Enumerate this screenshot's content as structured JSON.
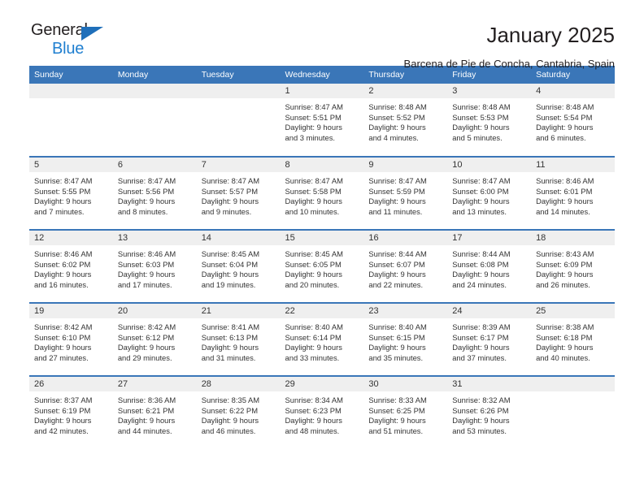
{
  "brand": {
    "name_top": "General",
    "name_bottom": "Blue",
    "triangle_color": "#1f6fba"
  },
  "header": {
    "title": "January 2025",
    "subtitle": "Barcena de Pie de Concha, Cantabria, Spain",
    "accent_color": "#3a76b8",
    "daynum_bg": "#efefef"
  },
  "weekdays": [
    "Sunday",
    "Monday",
    "Tuesday",
    "Wednesday",
    "Thursday",
    "Friday",
    "Saturday"
  ],
  "labels": {
    "sunrise": "Sunrise:",
    "sunset": "Sunset:",
    "daylight": "Daylight:"
  },
  "weeks": [
    [
      {
        "day": ""
      },
      {
        "day": ""
      },
      {
        "day": ""
      },
      {
        "day": "1",
        "sunrise": "Sunrise: 8:47 AM",
        "sunset": "Sunset: 5:51 PM",
        "daylight_1": "Daylight: 9 hours",
        "daylight_2": "and 3 minutes."
      },
      {
        "day": "2",
        "sunrise": "Sunrise: 8:48 AM",
        "sunset": "Sunset: 5:52 PM",
        "daylight_1": "Daylight: 9 hours",
        "daylight_2": "and 4 minutes."
      },
      {
        "day": "3",
        "sunrise": "Sunrise: 8:48 AM",
        "sunset": "Sunset: 5:53 PM",
        "daylight_1": "Daylight: 9 hours",
        "daylight_2": "and 5 minutes."
      },
      {
        "day": "4",
        "sunrise": "Sunrise: 8:48 AM",
        "sunset": "Sunset: 5:54 PM",
        "daylight_1": "Daylight: 9 hours",
        "daylight_2": "and 6 minutes."
      }
    ],
    [
      {
        "day": "5",
        "sunrise": "Sunrise: 8:47 AM",
        "sunset": "Sunset: 5:55 PM",
        "daylight_1": "Daylight: 9 hours",
        "daylight_2": "and 7 minutes."
      },
      {
        "day": "6",
        "sunrise": "Sunrise: 8:47 AM",
        "sunset": "Sunset: 5:56 PM",
        "daylight_1": "Daylight: 9 hours",
        "daylight_2": "and 8 minutes."
      },
      {
        "day": "7",
        "sunrise": "Sunrise: 8:47 AM",
        "sunset": "Sunset: 5:57 PM",
        "daylight_1": "Daylight: 9 hours",
        "daylight_2": "and 9 minutes."
      },
      {
        "day": "8",
        "sunrise": "Sunrise: 8:47 AM",
        "sunset": "Sunset: 5:58 PM",
        "daylight_1": "Daylight: 9 hours",
        "daylight_2": "and 10 minutes."
      },
      {
        "day": "9",
        "sunrise": "Sunrise: 8:47 AM",
        "sunset": "Sunset: 5:59 PM",
        "daylight_1": "Daylight: 9 hours",
        "daylight_2": "and 11 minutes."
      },
      {
        "day": "10",
        "sunrise": "Sunrise: 8:47 AM",
        "sunset": "Sunset: 6:00 PM",
        "daylight_1": "Daylight: 9 hours",
        "daylight_2": "and 13 minutes."
      },
      {
        "day": "11",
        "sunrise": "Sunrise: 8:46 AM",
        "sunset": "Sunset: 6:01 PM",
        "daylight_1": "Daylight: 9 hours",
        "daylight_2": "and 14 minutes."
      }
    ],
    [
      {
        "day": "12",
        "sunrise": "Sunrise: 8:46 AM",
        "sunset": "Sunset: 6:02 PM",
        "daylight_1": "Daylight: 9 hours",
        "daylight_2": "and 16 minutes."
      },
      {
        "day": "13",
        "sunrise": "Sunrise: 8:46 AM",
        "sunset": "Sunset: 6:03 PM",
        "daylight_1": "Daylight: 9 hours",
        "daylight_2": "and 17 minutes."
      },
      {
        "day": "14",
        "sunrise": "Sunrise: 8:45 AM",
        "sunset": "Sunset: 6:04 PM",
        "daylight_1": "Daylight: 9 hours",
        "daylight_2": "and 19 minutes."
      },
      {
        "day": "15",
        "sunrise": "Sunrise: 8:45 AM",
        "sunset": "Sunset: 6:05 PM",
        "daylight_1": "Daylight: 9 hours",
        "daylight_2": "and 20 minutes."
      },
      {
        "day": "16",
        "sunrise": "Sunrise: 8:44 AM",
        "sunset": "Sunset: 6:07 PM",
        "daylight_1": "Daylight: 9 hours",
        "daylight_2": "and 22 minutes."
      },
      {
        "day": "17",
        "sunrise": "Sunrise: 8:44 AM",
        "sunset": "Sunset: 6:08 PM",
        "daylight_1": "Daylight: 9 hours",
        "daylight_2": "and 24 minutes."
      },
      {
        "day": "18",
        "sunrise": "Sunrise: 8:43 AM",
        "sunset": "Sunset: 6:09 PM",
        "daylight_1": "Daylight: 9 hours",
        "daylight_2": "and 26 minutes."
      }
    ],
    [
      {
        "day": "19",
        "sunrise": "Sunrise: 8:42 AM",
        "sunset": "Sunset: 6:10 PM",
        "daylight_1": "Daylight: 9 hours",
        "daylight_2": "and 27 minutes."
      },
      {
        "day": "20",
        "sunrise": "Sunrise: 8:42 AM",
        "sunset": "Sunset: 6:12 PM",
        "daylight_1": "Daylight: 9 hours",
        "daylight_2": "and 29 minutes."
      },
      {
        "day": "21",
        "sunrise": "Sunrise: 8:41 AM",
        "sunset": "Sunset: 6:13 PM",
        "daylight_1": "Daylight: 9 hours",
        "daylight_2": "and 31 minutes."
      },
      {
        "day": "22",
        "sunrise": "Sunrise: 8:40 AM",
        "sunset": "Sunset: 6:14 PM",
        "daylight_1": "Daylight: 9 hours",
        "daylight_2": "and 33 minutes."
      },
      {
        "day": "23",
        "sunrise": "Sunrise: 8:40 AM",
        "sunset": "Sunset: 6:15 PM",
        "daylight_1": "Daylight: 9 hours",
        "daylight_2": "and 35 minutes."
      },
      {
        "day": "24",
        "sunrise": "Sunrise: 8:39 AM",
        "sunset": "Sunset: 6:17 PM",
        "daylight_1": "Daylight: 9 hours",
        "daylight_2": "and 37 minutes."
      },
      {
        "day": "25",
        "sunrise": "Sunrise: 8:38 AM",
        "sunset": "Sunset: 6:18 PM",
        "daylight_1": "Daylight: 9 hours",
        "daylight_2": "and 40 minutes."
      }
    ],
    [
      {
        "day": "26",
        "sunrise": "Sunrise: 8:37 AM",
        "sunset": "Sunset: 6:19 PM",
        "daylight_1": "Daylight: 9 hours",
        "daylight_2": "and 42 minutes."
      },
      {
        "day": "27",
        "sunrise": "Sunrise: 8:36 AM",
        "sunset": "Sunset: 6:21 PM",
        "daylight_1": "Daylight: 9 hours",
        "daylight_2": "and 44 minutes."
      },
      {
        "day": "28",
        "sunrise": "Sunrise: 8:35 AM",
        "sunset": "Sunset: 6:22 PM",
        "daylight_1": "Daylight: 9 hours",
        "daylight_2": "and 46 minutes."
      },
      {
        "day": "29",
        "sunrise": "Sunrise: 8:34 AM",
        "sunset": "Sunset: 6:23 PM",
        "daylight_1": "Daylight: 9 hours",
        "daylight_2": "and 48 minutes."
      },
      {
        "day": "30",
        "sunrise": "Sunrise: 8:33 AM",
        "sunset": "Sunset: 6:25 PM",
        "daylight_1": "Daylight: 9 hours",
        "daylight_2": "and 51 minutes."
      },
      {
        "day": "31",
        "sunrise": "Sunrise: 8:32 AM",
        "sunset": "Sunset: 6:26 PM",
        "daylight_1": "Daylight: 9 hours",
        "daylight_2": "and 53 minutes."
      },
      {
        "day": ""
      }
    ]
  ]
}
